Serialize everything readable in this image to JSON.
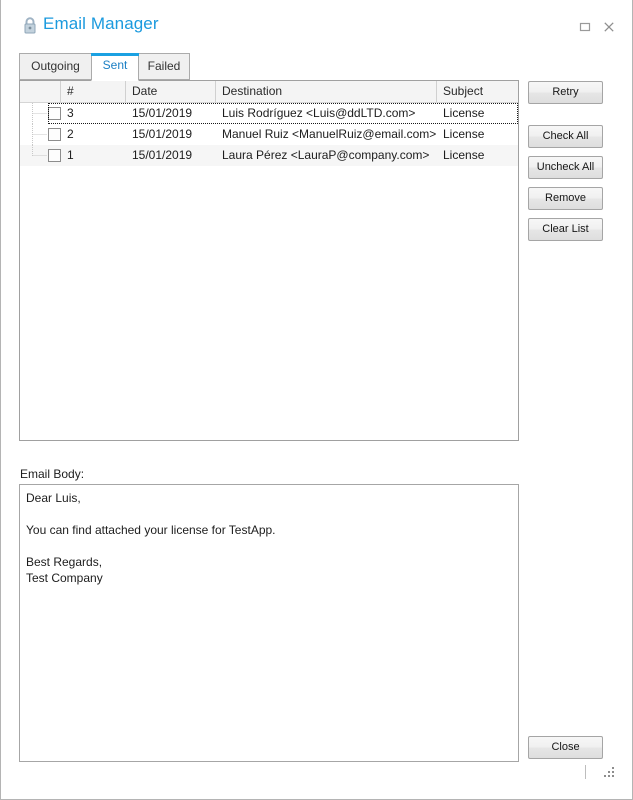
{
  "window": {
    "title": "Email Manager",
    "icon": "lock-icon",
    "controls": {
      "maximize": "maximize-icon",
      "close": "close-icon"
    },
    "accent_color": "#1b9ade"
  },
  "tabs": [
    {
      "label": "Outgoing",
      "active": false
    },
    {
      "label": "Sent",
      "active": true
    },
    {
      "label": "Failed",
      "active": false
    }
  ],
  "list": {
    "columns": [
      "",
      "#",
      "Date",
      "Destination",
      "Subject"
    ],
    "rows": [
      {
        "checked": false,
        "num": "3",
        "date": "15/01/2019",
        "destination": "Luis Rodríguez <Luis@ddLTD.com>",
        "subject": "License"
      },
      {
        "checked": false,
        "num": "2",
        "date": "15/01/2019",
        "destination": "Manuel Ruiz <ManuelRuiz@email.com>",
        "subject": "License"
      },
      {
        "checked": false,
        "num": "1",
        "date": "15/01/2019",
        "destination": "Laura Pérez <LauraP@company.com>",
        "subject": "License"
      }
    ]
  },
  "buttons": {
    "retry": "Retry",
    "check_all": "Check All",
    "uncheck_all": "Uncheck All",
    "remove": "Remove",
    "clear_list": "Clear List",
    "close": "Close"
  },
  "email_body": {
    "label": "Email Body:",
    "text": "Dear Luis,\n\nYou can find attached your license for TestApp.\n\nBest Regards,\nTest Company"
  }
}
